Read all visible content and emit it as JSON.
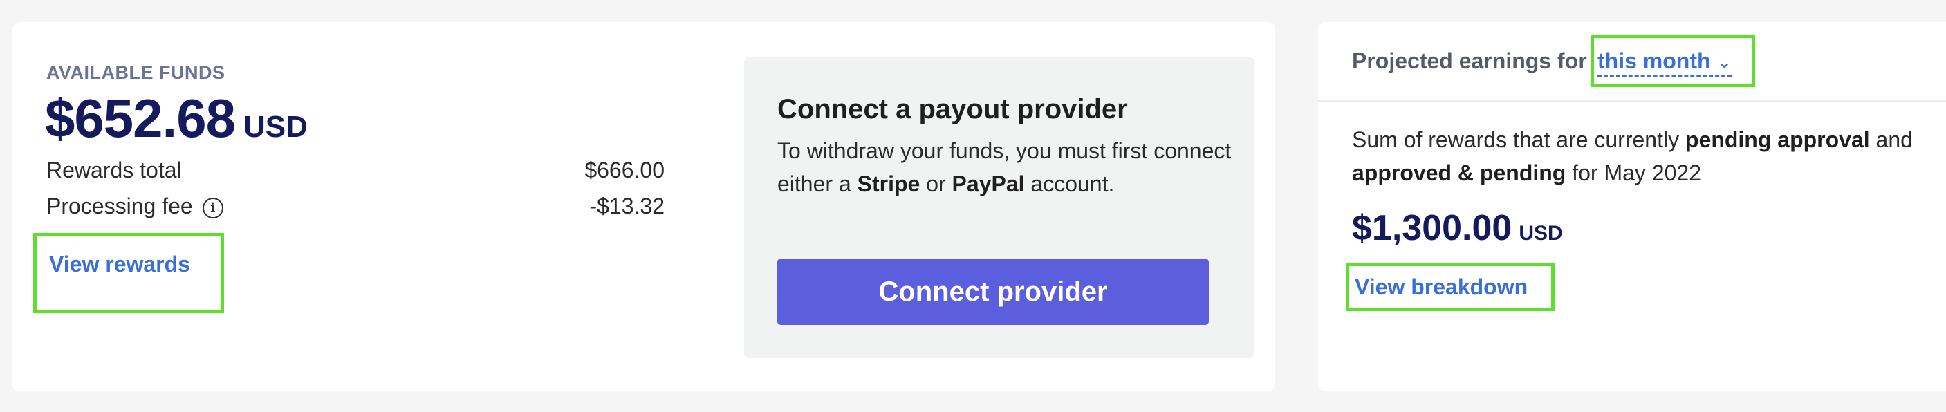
{
  "funds": {
    "label": "AVAILABLE FUNDS",
    "amount": "$652.68",
    "currency": "USD",
    "rows": [
      {
        "label": "Rewards total",
        "value": "$666.00"
      },
      {
        "label": "Processing fee",
        "value": "-$13.32",
        "icon": "info-icon"
      }
    ],
    "view_rewards": "View rewards"
  },
  "payout": {
    "title": "Connect a payout provider",
    "desc_part1": "To withdraw your funds, you must first connect either a ",
    "stripe": "Stripe",
    "or": " or ",
    "paypal": "PayPal",
    "desc_part2": " account.",
    "button": "Connect provider"
  },
  "earnings": {
    "header_prefix": "Projected earnings for",
    "period": "this month",
    "desc_part1": "Sum of rewards that are currently ",
    "pending_approval": "pending approval",
    "and": " and ",
    "approved_pending": "approved & pending",
    "desc_part2": " for May 2022",
    "amount": "$1,300.00",
    "currency": "USD",
    "view_breakdown": "View breakdown"
  },
  "colors": {
    "accent_link": "#3a6fd8",
    "button": "#5c5fdd",
    "amount": "#141a5c",
    "highlight": "#5ee02a"
  }
}
